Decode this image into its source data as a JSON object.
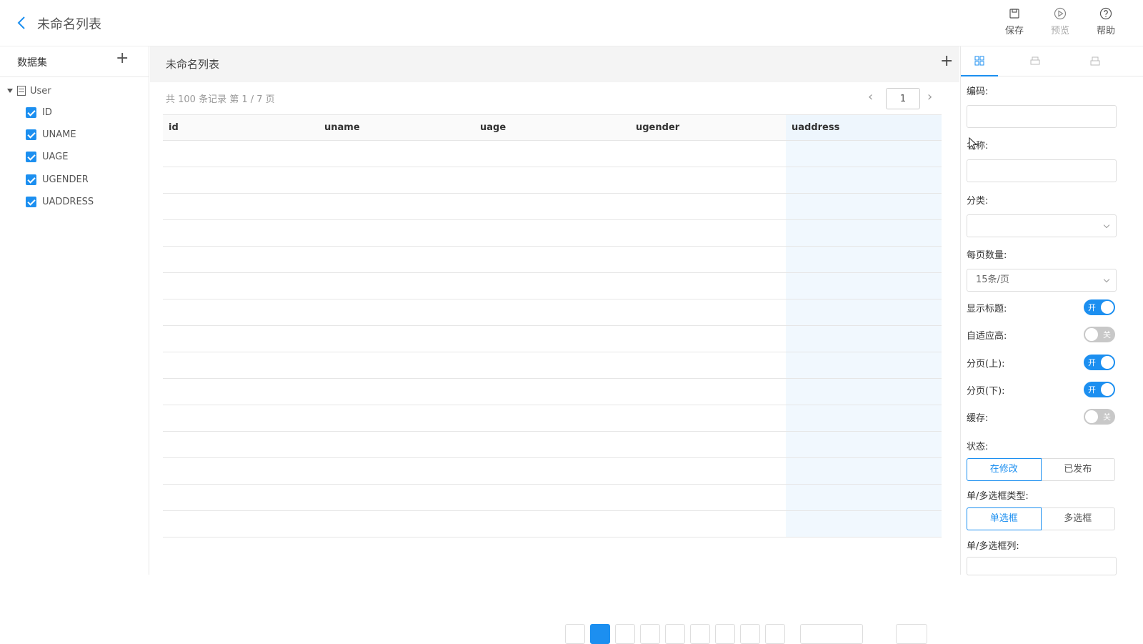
{
  "header": {
    "title": "未命名列表",
    "actions": [
      {
        "label": "保存",
        "icon": "save-icon"
      },
      {
        "label": "预览",
        "icon": "play-icon"
      },
      {
        "label": "帮助",
        "icon": "help-icon"
      }
    ]
  },
  "sidebar": {
    "title": "数据集",
    "dataset": "User",
    "fields": [
      "ID",
      "UNAME",
      "UAGE",
      "UGENDER",
      "UADDRESS"
    ]
  },
  "main": {
    "title": "未命名列表",
    "record_info": "共 100 条记录  第 1 / 7 页",
    "page_input": "1",
    "columns": [
      "id",
      "uname",
      "uage",
      "ugender",
      "uaddress"
    ],
    "selected_column": "uaddress"
  },
  "panel": {
    "code_label": "编码:",
    "name_label": "名称:",
    "category_label": "分类:",
    "page_size_label": "每页数量:",
    "page_size_value": "15条/页",
    "toggles": [
      {
        "label": "显示标题:",
        "state": "on",
        "text": "开"
      },
      {
        "label": "自适应高:",
        "state": "off",
        "text": "关"
      },
      {
        "label": "分页(上):",
        "state": "on",
        "text": "开"
      },
      {
        "label": "分页(下):",
        "state": "on",
        "text": "开"
      },
      {
        "label": "缓存:",
        "state": "off",
        "text": "关"
      }
    ],
    "status_label": "状态:",
    "status_options": [
      "在修改",
      "已发布"
    ],
    "select_type_label": "单/多选框类型:",
    "select_type_options": [
      "单选框",
      "多选框"
    ],
    "select_col_label": "单/多选框列:"
  },
  "colors": {
    "accent": "#1c8ff0",
    "selected_col": "#f1f8fe"
  }
}
